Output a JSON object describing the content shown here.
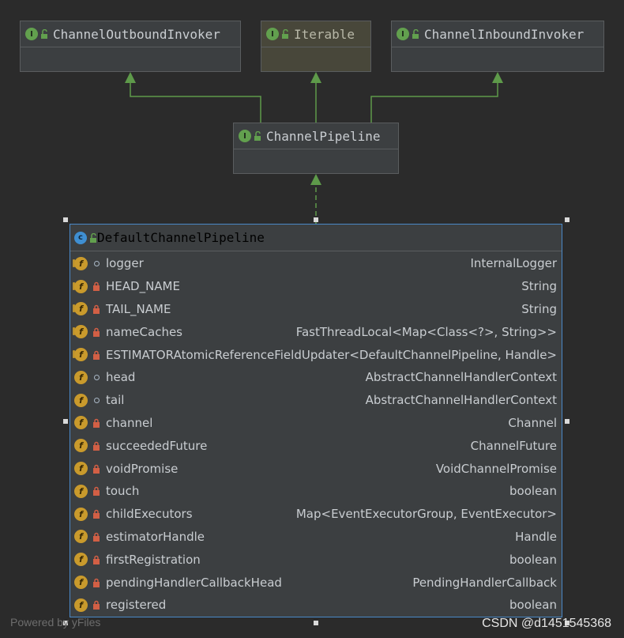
{
  "nodes": {
    "outbound": {
      "name": "ChannelOutboundInvoker",
      "kind": "I"
    },
    "iterable": {
      "name": "Iterable",
      "kind": "I"
    },
    "inbound": {
      "name": "ChannelInboundInvoker",
      "kind": "I"
    },
    "pipeline": {
      "name": "ChannelPipeline",
      "kind": "I"
    },
    "default": {
      "name": "DefaultChannelPipeline",
      "kind": "C"
    }
  },
  "fields": [
    {
      "name": "logger",
      "type": "InternalLogger",
      "static": true,
      "visibility": "package"
    },
    {
      "name": "HEAD_NAME",
      "type": "String",
      "static": true,
      "visibility": "private"
    },
    {
      "name": "TAIL_NAME",
      "type": "String",
      "static": true,
      "visibility": "private"
    },
    {
      "name": "nameCaches",
      "type": "FastThreadLocal<Map<Class<?>, String>>",
      "static": true,
      "visibility": "private"
    },
    {
      "name": "ESTIMATOR",
      "type": "AtomicReferenceFieldUpdater<DefaultChannelPipeline, Handle>",
      "static": true,
      "visibility": "private"
    },
    {
      "name": "head",
      "type": "AbstractChannelHandlerContext",
      "static": false,
      "visibility": "package"
    },
    {
      "name": "tail",
      "type": "AbstractChannelHandlerContext",
      "static": false,
      "visibility": "package"
    },
    {
      "name": "channel",
      "type": "Channel",
      "static": false,
      "visibility": "private"
    },
    {
      "name": "succeededFuture",
      "type": "ChannelFuture",
      "static": false,
      "visibility": "private"
    },
    {
      "name": "voidPromise",
      "type": "VoidChannelPromise",
      "static": false,
      "visibility": "private"
    },
    {
      "name": "touch",
      "type": "boolean",
      "static": false,
      "visibility": "private"
    },
    {
      "name": "childExecutors",
      "type": "Map<EventExecutorGroup, EventExecutor>",
      "static": false,
      "visibility": "private"
    },
    {
      "name": "estimatorHandle",
      "type": "Handle",
      "static": false,
      "visibility": "private"
    },
    {
      "name": "firstRegistration",
      "type": "boolean",
      "static": false,
      "visibility": "private"
    },
    {
      "name": "pendingHandlerCallbackHead",
      "type": "PendingHandlerCallback",
      "static": false,
      "visibility": "private"
    },
    {
      "name": "registered",
      "type": "boolean",
      "static": false,
      "visibility": "private"
    }
  ],
  "footer": {
    "powered": "Powered by yFiles",
    "watermark": "CSDN @d1451545368"
  },
  "colors": {
    "background": "#2b2b2b",
    "node": "#3c3f41",
    "edge": "#5e9a4a",
    "selection": "#4a88c7",
    "field_badge": "#c99a2c",
    "private_lock": "#d25f45"
  }
}
